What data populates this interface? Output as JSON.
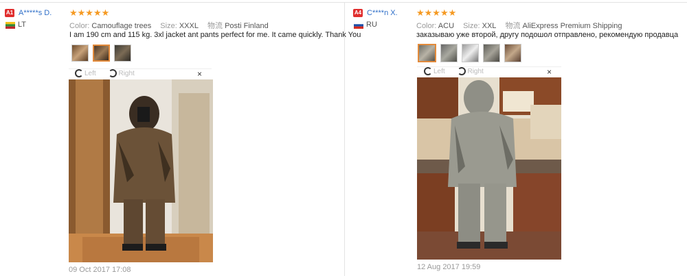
{
  "reviews": [
    {
      "badge": "A1",
      "username": "A*****s D.",
      "country": "LT",
      "stars": "★★★★★",
      "color_label": "Color:",
      "color_value": "Camouflage trees",
      "size_label": "Size:",
      "size_value": "XXXL",
      "ship_label": "物流",
      "ship_value": "Posti Finland",
      "text": "I am 190 cm and 115 kg. 3xl jacket ant pants perfect for me. It came quickly. Thank You",
      "rotate_left": "Left",
      "rotate_right": "Right",
      "close": "×",
      "date": "09 Oct 2017 17:08"
    },
    {
      "badge": "A4",
      "username": "C****n X.",
      "country": "RU",
      "stars": "★★★★★",
      "color_label": "Color:",
      "color_value": "ACU",
      "size_label": "Size:",
      "size_value": "XXL",
      "ship_label": "物流",
      "ship_value": "AliExpress Premium Shipping",
      "text": "заказываю уже второй, другу подошол отправлено, рекомендую продавца",
      "rotate_left": "Left",
      "rotate_right": "Right",
      "close": "×",
      "date": "12 Aug 2017 19:59"
    }
  ],
  "colors": {
    "star": "#f59a23",
    "username": "#2f6fc8",
    "badge": "#e02e2e",
    "thumb_selected": "#e38a3a"
  }
}
